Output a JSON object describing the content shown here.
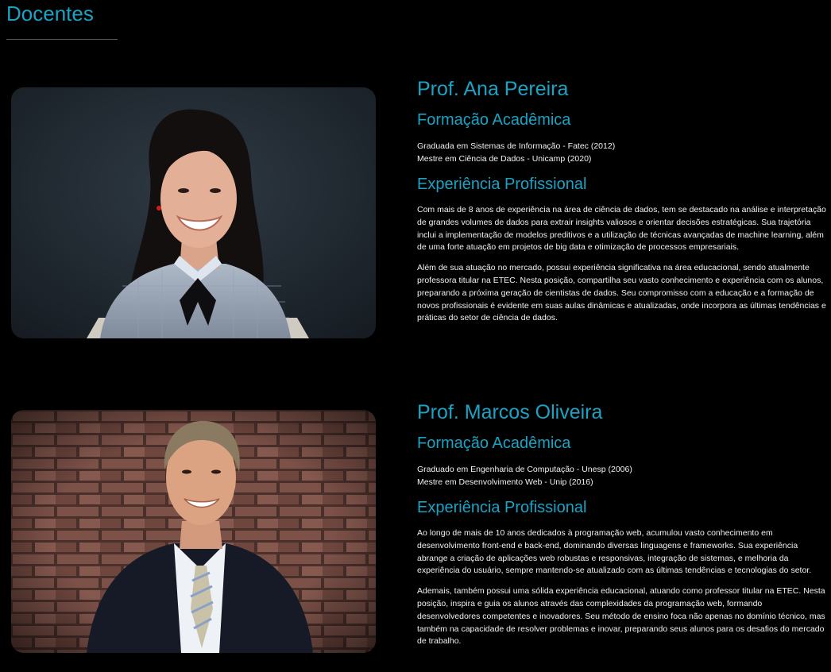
{
  "section": {
    "title": "Docentes"
  },
  "colors": {
    "accent": "#1aa3c4",
    "background": "#000000",
    "text": "#f2f2f2"
  },
  "docentes": [
    {
      "name": "Prof. Ana Pereira",
      "formacao_title": "Formação Acadêmica",
      "formacao": [
        "Graduada em Sistemas de Informação - Fatec (2012)",
        "Mestre em Ciência de Dados - Unicamp (2020)"
      ],
      "experiencia_title": "Experiência Profissional",
      "experiencia": [
        "Com mais de 8 anos de experiência na área de ciência de dados, tem se destacado na análise e interpretação de grandes volumes de dados para extrair insights valiosos e orientar decisões estratégicas. Sua trajetória inclui a implementação de modelos preditivos e a utilização de técnicas avançadas de machine learning, além de uma forte atuação em projetos de big data e otimização de processos empresariais.",
        "Além de sua atuação no mercado, possui experiência significativa na área educacional, sendo atualmente professora titular na ETEC. Nesta posição, compartilha seu vasto conhecimento e experiência com os alunos, preparando a próxima geração de cientistas de dados. Seu compromisso com a educação e a formação de novos profissionais é evidente em suas aulas dinâmicas e atualizadas, onde incorpora as últimas tendências e práticas do setor de ciência de dados."
      ]
    },
    {
      "name": "Prof. Marcos Oliveira",
      "formacao_title": "Formação Acadêmica",
      "formacao": [
        "Graduado em Engenharia de Computação - Unesp (2006)",
        "Mestre em Desenvolvimento Web - Unip (2016)"
      ],
      "experiencia_title": "Experiência Profissional",
      "experiencia": [
        "Ao longo de mais de 10 anos dedicados à programação web, acumulou vasto conhecimento em desenvolvimento front-end e back-end, dominando diversas linguagens e frameworks. Sua experiência abrange a criação de aplicações web robustas e responsivas, integração de sistemas, e melhoria da experiência do usuário, sempre mantendo-se atualizado com as últimas tendências e tecnologias do setor.",
        "Ademais, também possui uma sólida experiência educacional, atuando como professor titular na ETEC. Nesta posição, inspira e guia os alunos através das complexidades da programação web, formando desenvolvedores competentes e inovadores. Seu método de ensino foca não apenas no domínio técnico, mas também na capacidade de resolver problemas e inovar, preparando seus alunos para os desafios do mercado de trabalho."
      ]
    }
  ]
}
